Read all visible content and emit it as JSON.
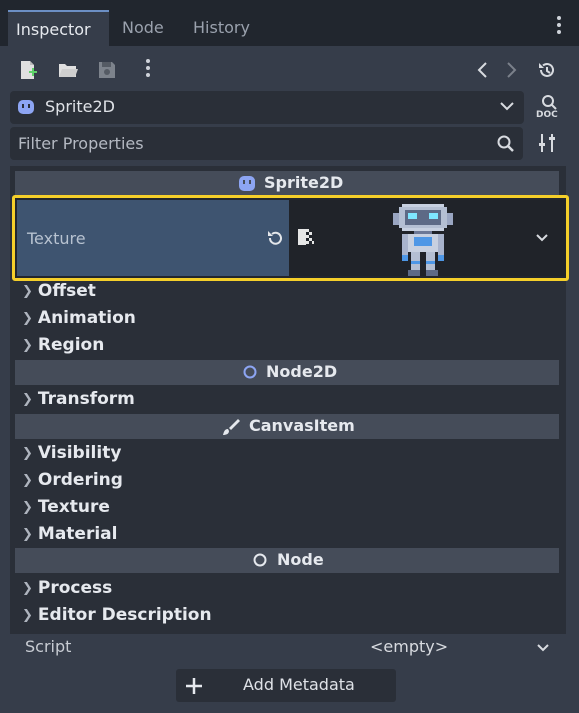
{
  "tabs": [
    {
      "label": "Inspector",
      "active": true
    },
    {
      "label": "Node",
      "active": false
    },
    {
      "label": "History",
      "active": false
    }
  ],
  "toolbar": {
    "icons": [
      "new-resource-icon",
      "open-folder-icon",
      "save-icon",
      "more-icon",
      "back-icon",
      "forward-icon",
      "history-icon"
    ]
  },
  "node_selector": {
    "value": "Sprite2D",
    "doc_label": "DOC"
  },
  "filter": {
    "placeholder": "Filter Properties"
  },
  "sections": {
    "sprite2d": "Sprite2D",
    "node2d": "Node2D",
    "canvasitem": "CanvasItem",
    "node": "Node"
  },
  "texture": {
    "label": "Texture"
  },
  "groups": {
    "offset": "Offset",
    "animation": "Animation",
    "region": "Region",
    "transform": "Transform",
    "visibility": "Visibility",
    "ordering": "Ordering",
    "texture": "Texture",
    "material": "Material",
    "process": "Process",
    "editor_description": "Editor Description"
  },
  "script": {
    "label": "Script",
    "value": "<empty>"
  },
  "add_metadata": {
    "label": "Add Metadata"
  },
  "colors": {
    "accent": "#6c8fc4",
    "highlight_border": "#f5cf2a",
    "node_icon": "#8da5f3"
  }
}
